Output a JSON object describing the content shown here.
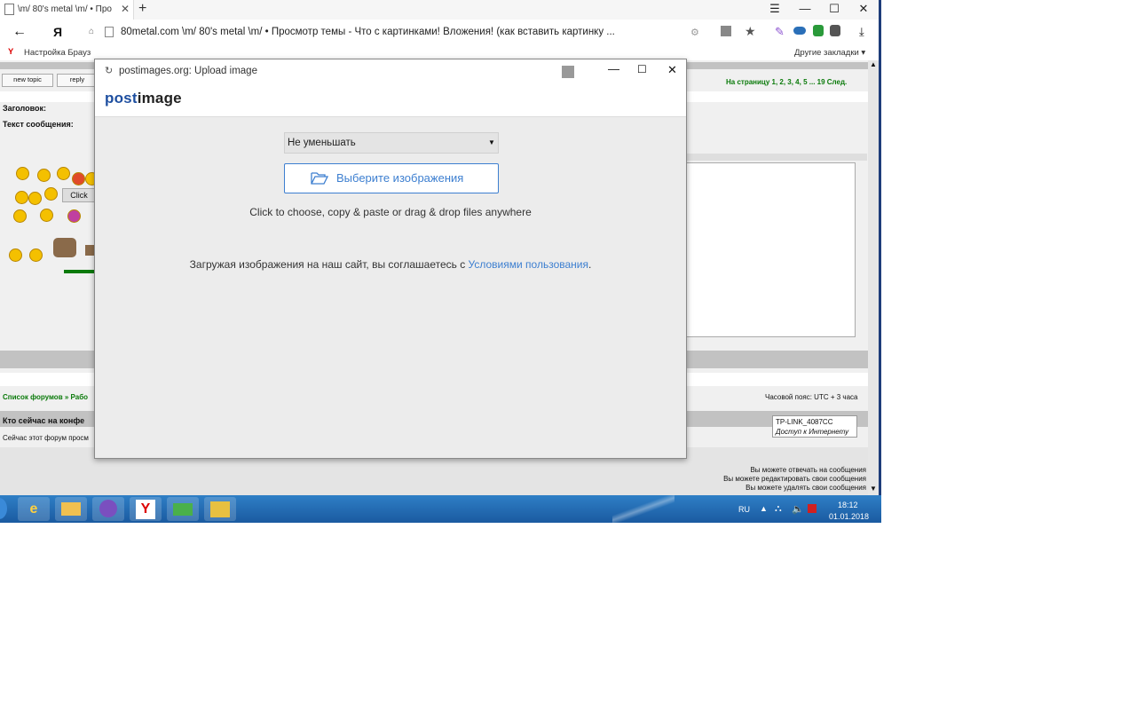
{
  "browser": {
    "tab_title": "\\m/ 80's metal \\m/ • Про",
    "new_tab": "+",
    "window_controls": {
      "menu": "☰",
      "minimize": "—",
      "maximize": "☐",
      "close": "✕"
    },
    "url": "80metal.com   \\m/ 80's metal \\m/ • Просмотр темы - Что с картинками! Вложения! (как вставить картинку ...",
    "address_letter": "Я",
    "bookmarks_left": "Настройка Брауз",
    "bookmarks_right": "Другие закладки ▾"
  },
  "forum_page": {
    "new_topic": "new topic",
    "reply": "reply",
    "pagination": "На страницу 1, 2, 3, 4, 5 ... 19  След.",
    "subject_label": "Заголовок:",
    "message_label": "Текст сообщения:",
    "click_hint": "Click",
    "breadcrumb": "Список форумов » Рабо",
    "timezone": "Часовой пояс: UTC + 3 часа",
    "who_online": "Кто сейчас на конфе",
    "browsing": "Сейчас этот форум просм",
    "permissions": [
      "Вы можете отвечать на сообщения",
      "Вы можете редактировать свои сообщения",
      "Вы можете удалять свои сообщения"
    ]
  },
  "tooltip": {
    "line1": "TP-LINK_4087CC",
    "line2": "Доступ к Интернету"
  },
  "taskbar": {
    "icons": [
      "ie-icon",
      "explorer-icon",
      "viber-icon",
      "yandex-icon",
      "network-icon",
      "files-icon"
    ],
    "lang": "RU",
    "time": "18:12",
    "date": "01.01.2018"
  },
  "popup": {
    "title": "postimages.org: Upload image",
    "logo_post": "post",
    "logo_image": "image",
    "resize_selected": "Не уменьшать",
    "choose_button": "Выберите изображения",
    "hint": "Click to choose, copy & paste or drag & drop files anywhere",
    "terms_prefix": "Загружая изображения на наш сайт, вы соглашаетесь с ",
    "terms_link": "Условиями пользования",
    "terms_suffix": "."
  },
  "colors": {
    "accent": "#3d7fd0",
    "taskbar": "#2f7fc6",
    "forum_green": "#0a7a0a"
  }
}
